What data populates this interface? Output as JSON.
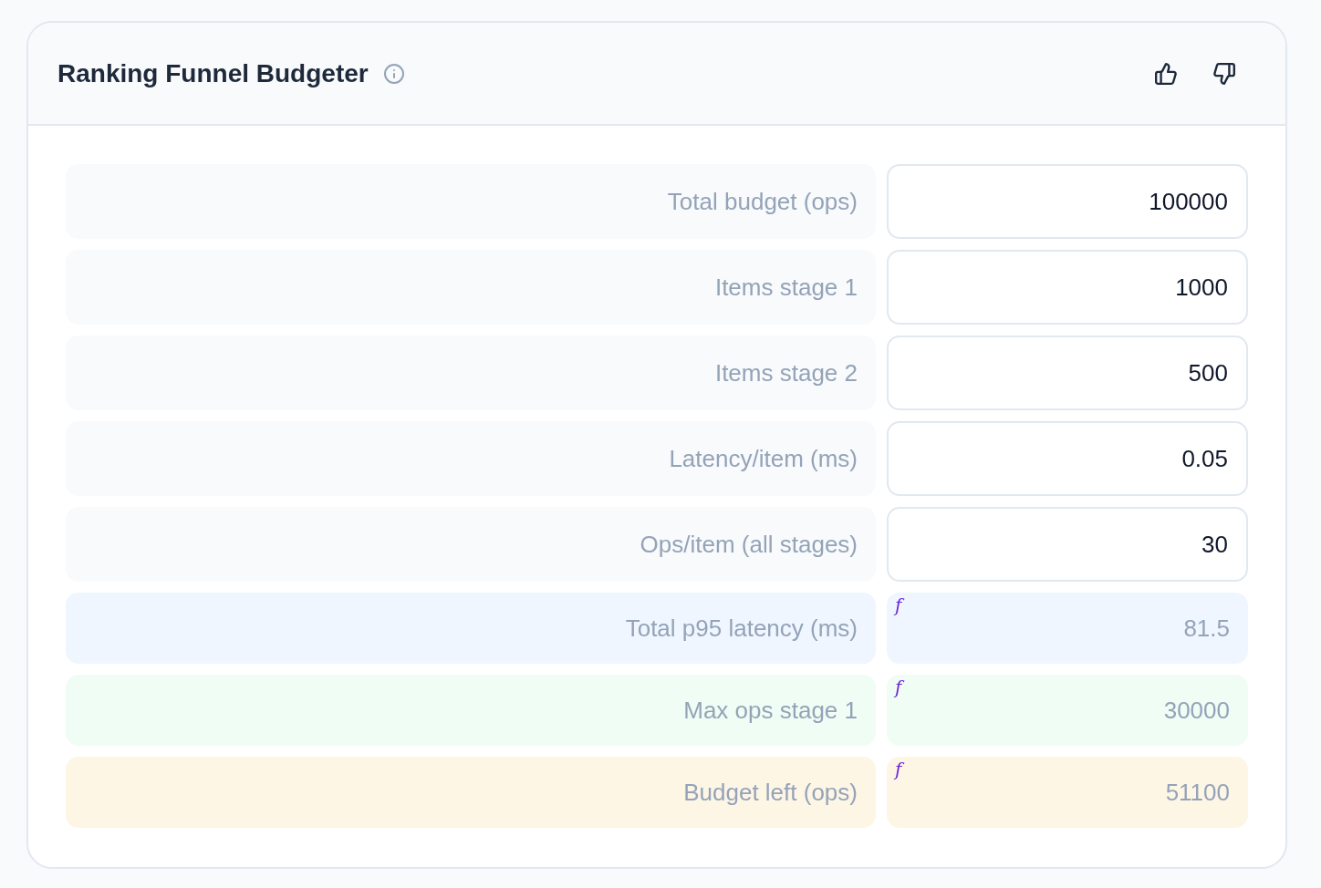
{
  "card": {
    "title": "Ranking Funnel Budgeter"
  },
  "fields": [
    {
      "kind": "input",
      "label": "Total budget (ops)",
      "value": "100000"
    },
    {
      "kind": "input",
      "label": "Items stage 1",
      "value": "1000"
    },
    {
      "kind": "input",
      "label": "Items stage 2",
      "value": "500"
    },
    {
      "kind": "input",
      "label": "Latency/item (ms)",
      "value": "0.05"
    },
    {
      "kind": "input",
      "label": "Ops/item (all stages)",
      "value": "30"
    },
    {
      "kind": "computed",
      "label": "Total p95 latency (ms)",
      "value": "81.5",
      "marker": "f",
      "color": "#eff6ff"
    },
    {
      "kind": "computed",
      "label": "Max ops stage 1",
      "value": "30000",
      "marker": "f",
      "color": "#f0fdf4"
    },
    {
      "kind": "computed",
      "label": "Budget left (ops)",
      "value": "51100",
      "marker": "f",
      "color": "#fef6e5"
    }
  ]
}
